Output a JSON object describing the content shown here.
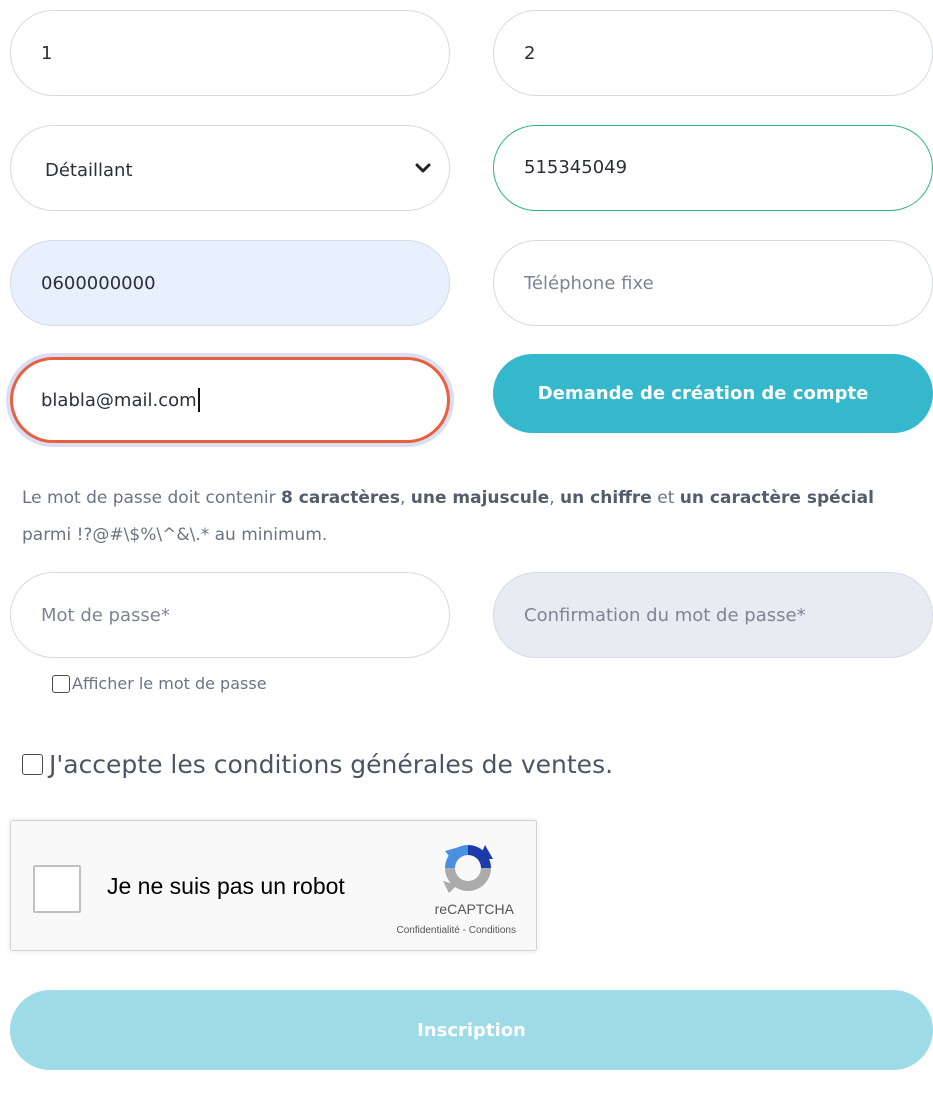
{
  "form": {
    "field1_value": "1",
    "field2_value": "2",
    "type_select_value": "Détaillant",
    "siret_value": "515345049",
    "mobile_value": "0600000000",
    "landline_placeholder": "Téléphone fixe",
    "email_value": "blabla@mail.com",
    "account_request_label": "Demande de création de compte",
    "password_placeholder": "Mot de passe*",
    "password_confirm_placeholder": "Confirmation du mot de passe*",
    "show_password_label": "Afficher le mot de passe",
    "terms_label": "J'accepte les conditions générales de ventes.",
    "submit_label": "Inscription"
  },
  "password_hint": {
    "prefix": "Le mot de passe doit contenir ",
    "length": "8 caractères",
    "sep1": ", ",
    "uppercase": "une majuscule",
    "sep2": ", ",
    "digit": "un chiffre",
    "sep3": " et ",
    "special": "un caractère spécial",
    "suffix": " parmi !?@#\\$%\\^&\\.* au minimum."
  },
  "recaptcha": {
    "label": "Je ne suis pas un robot",
    "brand": "reCAPTCHA",
    "privacy": "Confidentialité",
    "separator": " - ",
    "terms": "Conditions",
    "logo_icon": "recaptcha-logo-icon"
  },
  "colors": {
    "accent": "#35b8cc",
    "accent_disabled": "#9ddbe6",
    "valid_border": "#2bb58a",
    "focus_border": "#e8603c"
  }
}
